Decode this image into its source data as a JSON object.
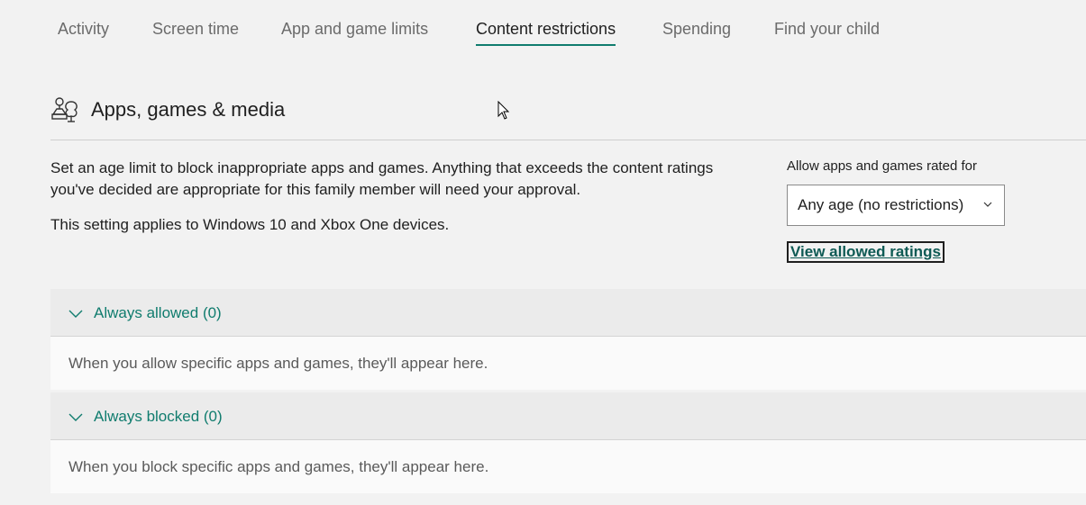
{
  "tabs": [
    {
      "label": "Activity"
    },
    {
      "label": "Screen time"
    },
    {
      "label": "App and game limits"
    },
    {
      "label": "Content restrictions",
      "active": true
    },
    {
      "label": "Spending"
    },
    {
      "label": "Find your child"
    }
  ],
  "section": {
    "icon": "apps-games-media-icon",
    "title": "Apps, games & media",
    "description": "Set an age limit to block inappropriate apps and games. Anything that exceeds the content ratings you've decided are appropriate for this family member will need your approval.",
    "note": "This setting applies to Windows 10 and Xbox One devices."
  },
  "rating": {
    "label": "Allow apps and games rated for",
    "selected": "Any age (no restrictions)",
    "link": "View allowed ratings"
  },
  "accordions": [
    {
      "title": "Always allowed (0)",
      "body": "When you allow specific apps and games, they'll appear here."
    },
    {
      "title": "Always blocked (0)",
      "body": "When you block specific apps and games, they'll appear here."
    }
  ],
  "colors": {
    "accent": "#107c6e",
    "background": "#f2f2f2"
  }
}
